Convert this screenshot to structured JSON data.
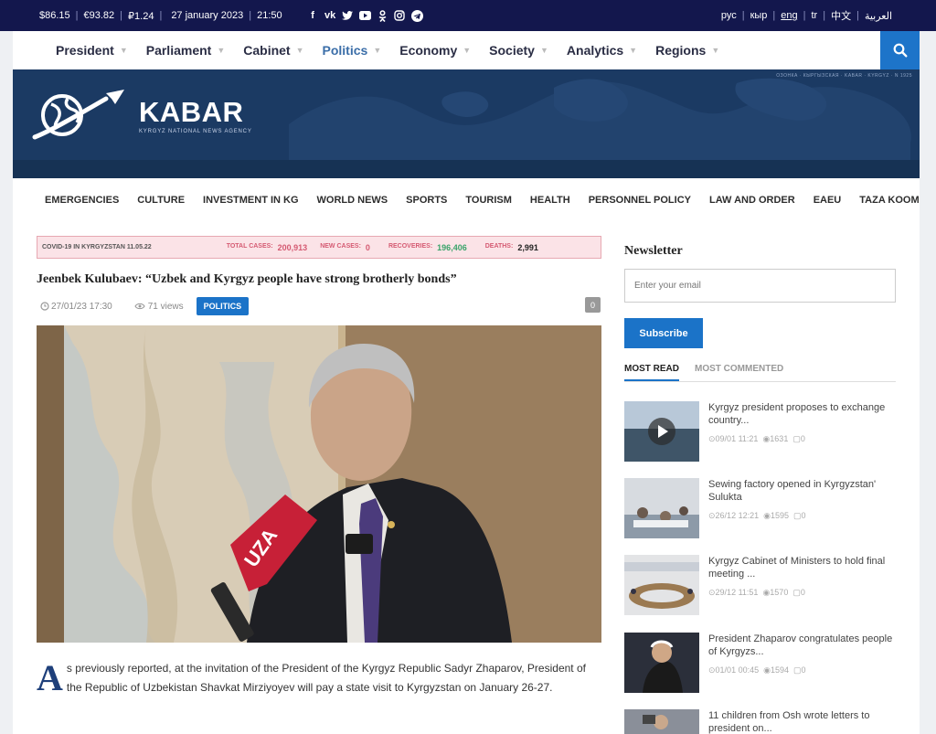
{
  "topbar": {
    "usd": "$86.15",
    "eur": "€93.82",
    "rub": "₽1.24",
    "date": "27 january 2023",
    "time": "21:50",
    "languages": [
      "рус",
      "кыр",
      "eng",
      "tr",
      "中文",
      "العربية"
    ]
  },
  "mainnav": {
    "items": [
      "President",
      "Parliament",
      "Cabinet",
      "Politics",
      "Economy",
      "Society",
      "Analytics",
      "Regions"
    ]
  },
  "logo": {
    "name": "KABAR",
    "tagline": "KYRGYZ NATIONAL NEWS AGENCY"
  },
  "banner_crumb": "ОЗОНКА · КЫРГЫЗСКАЯ · KABAR · KYRGYZ · N 1925",
  "subnav": {
    "items": [
      "EMERGENCIES",
      "CULTURE",
      "INVESTMENT IN KG",
      "WORLD NEWS",
      "SPORTS",
      "TOURISM",
      "HEALTH",
      "PERSONNEL POLICY",
      "LAW AND ORDER",
      "EAEU",
      "TAZA KOOM"
    ]
  },
  "covid": {
    "label": "COVID-19 IN KYRGYZSTAN 11.05.22",
    "total_label": "TOTAL CASES:",
    "total": "200,913",
    "new_label": "NEW CASES:",
    "new": "0",
    "recovered_label": "RECOVERIES:",
    "recovered": "196,406",
    "deaths_label": "DEATHS:",
    "deaths": "2,991"
  },
  "article": {
    "title": "Jeenbek Kulubaev: “Uzbek and Kyrgyz people have strong brotherly bonds”",
    "date": "27/01/23 17:30",
    "views": "71 views",
    "category": "POLITICS",
    "comments": "0",
    "dropcap": "A",
    "body": "s previously reported, at the invitation of the President of the Kyrgyz Republic Sadyr Zhaparov, President of the Republic of Uzbekistan Shavkat Mirziyoyev will pay a state visit to Kyrgyzstan on January 26-27."
  },
  "sidebar": {
    "newsletter_title": "Newsletter",
    "email_placeholder": "Enter your email",
    "subscribe_label": "Subscribe",
    "tab_most_read": "MOST READ",
    "tab_most_commented": "MOST COMMENTED",
    "news": [
      {
        "title": "Kyrgyz president proposes to exchange country...",
        "date": "09/01 11:21",
        "views": "1631",
        "comments": "0"
      },
      {
        "title": "Sewing factory opened in Kyrgyzstan' Sulukta",
        "date": "26/12 12:21",
        "views": "1595",
        "comments": "0"
      },
      {
        "title": "Kyrgyz Cabinet of Ministers to hold final meeting ...",
        "date": "29/12 11:51",
        "views": "1570",
        "comments": "0"
      },
      {
        "title": "President Zhaparov congratulates people of Kyrgyzs...",
        "date": "01/01 00:45",
        "views": "1594",
        "comments": "0"
      },
      {
        "title": "11 children from Osh wrote letters to president on..."
      }
    ]
  },
  "colors": {
    "topbar": "#13174d",
    "accent": "#1b73c8",
    "banner": "#1b3a63"
  }
}
